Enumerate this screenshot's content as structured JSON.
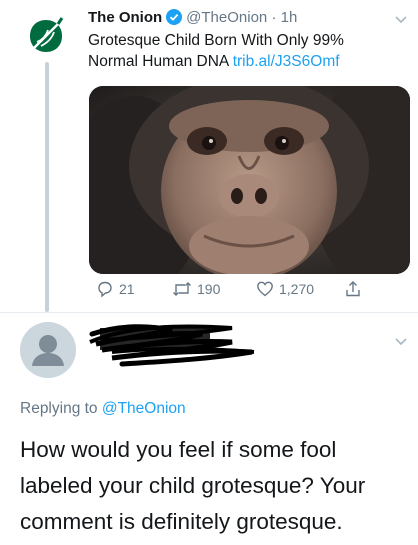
{
  "tweet": {
    "author_name": "The Onion",
    "handle": "@TheOnion",
    "separator": "·",
    "time": "1h",
    "text": "Grotesque Child Born With Only 99% Normal Human DNA ",
    "link": "trib.al/J3S6Omf",
    "media_description": "chimpanzee-photo",
    "actions": {
      "reply_count": "21",
      "retweet_count": "190",
      "like_count": "1,270"
    }
  },
  "reply": {
    "replying_label": "Replying to ",
    "replying_mention": "@TheOnion",
    "text": "How would you feel if some fool labeled your child grotesque? Your comment is definitely grotesque."
  },
  "colors": {
    "accent": "#1da1f2",
    "muted": "#657786",
    "onion_green": "#006b3f"
  },
  "icons": [
    "onion-logo-icon",
    "verified-badge-icon",
    "chevron-down-icon",
    "reply-icon",
    "retweet-icon",
    "like-icon",
    "share-icon",
    "default-avatar-icon"
  ]
}
